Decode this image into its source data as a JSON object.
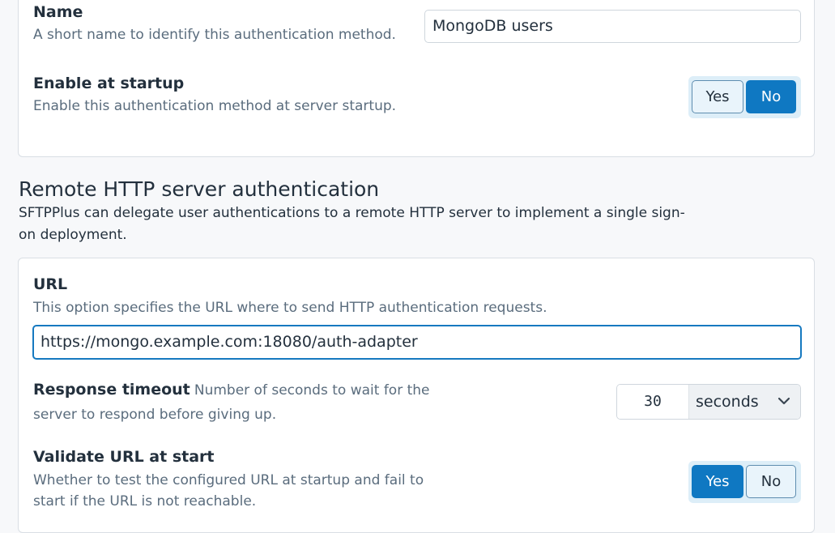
{
  "general": {
    "name": {
      "label": "Name",
      "help": "A short name to identify this authentication method.",
      "value": "MongoDB users"
    },
    "enable_startup": {
      "label": "Enable at startup",
      "help": "Enable this authentication method at server startup.",
      "yes_label": "Yes",
      "no_label": "No",
      "selected": "No"
    }
  },
  "remote_http": {
    "title": "Remote HTTP server authentication",
    "description": "SFTPPlus can delegate user authentications to a remote HTTP server to implement a single sign-on deployment.",
    "url": {
      "label": "URL",
      "help": "This option specifies the URL where to send HTTP authentication requests.",
      "value": "https://mongo.example.com:18080/auth-adapter"
    },
    "timeout": {
      "label": "Response timeout",
      "help_line1": "Number of seconds to wait for the",
      "help_line2": "server to respond before giving up.",
      "value": "30",
      "unit": "seconds"
    },
    "validate": {
      "label": "Validate URL at start",
      "help_line1": "Whether to test the configured URL at startup and fail to",
      "help_line2": "start if the URL is not reachable.",
      "yes_label": "Yes",
      "no_label": "No",
      "selected": "Yes"
    }
  },
  "colors": {
    "accent": "#0f78c2",
    "toggle_bg": "#ddeef8",
    "help_text": "#5a6c7d"
  },
  "icons": {
    "unit_dropdown": "chevron-down-icon"
  }
}
